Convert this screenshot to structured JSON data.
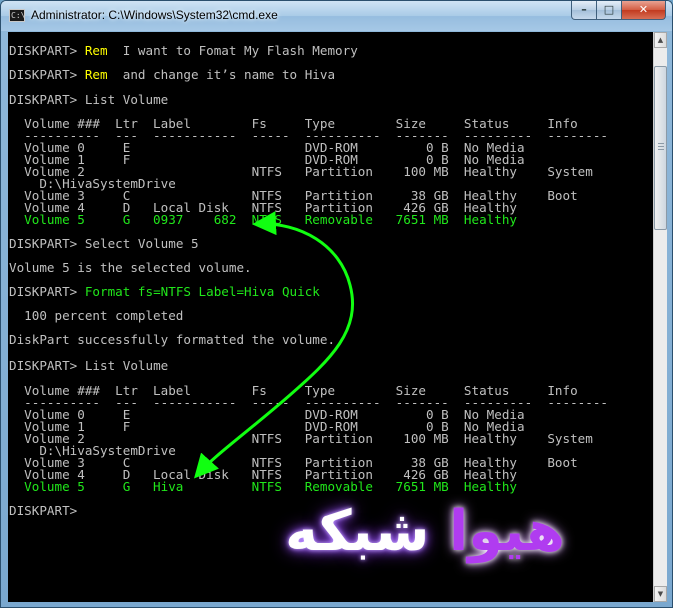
{
  "window": {
    "title": "Administrator: C:\\Windows\\System32\\cmd.exe",
    "app_icon": "C:\\",
    "controls": {
      "minimize": "–",
      "maximize": "□",
      "close": "✕"
    }
  },
  "console": {
    "lines": [
      {
        "prompt": "DISKPART> ",
        "cmd": "Rem",
        "rest": "  I want to Fomat My Flash Memory"
      },
      {
        "prompt": "DISKPART> ",
        "cmd": "Rem",
        "rest": "  and change it’s name to Hiva"
      },
      {
        "prompt": "DISKPART> ",
        "cmd": "",
        "rest": "List Volume"
      },
      {
        "text": "  Volume ###  Ltr  Label        Fs     Type        Size     Status     Info"
      },
      {
        "text": "  ----------  ---  -----------  -----  ----------  -------  ---------  --------"
      },
      {
        "text": "  Volume 0     E                       DVD-ROM         0 B  No Media"
      },
      {
        "text": "  Volume 1     F                       DVD-ROM         0 B  No Media"
      },
      {
        "text": "  Volume 2                      NTFS   Partition    100 MB  Healthy    System"
      },
      {
        "text": "    D:\\HivaSystemDrive"
      },
      {
        "text": "  Volume 3     C                NTFS   Partition     38 GB  Healthy    Boot"
      },
      {
        "text": "  Volume 4     D   Local Disk   NTFS   Partition    426 GB  Healthy"
      },
      {
        "text": "  Volume 5     G   0937    682  NTFS   Removable   7651 MB  Healthy",
        "green": true
      },
      {
        "prompt": "DISKPART> ",
        "cmd": "",
        "rest": "Select Volume 5"
      },
      {
        "text": "Volume 5 is the selected volume."
      },
      {
        "prompt": "DISKPART> ",
        "cmd": "Format fs=NTFS Label=Hiva Quick",
        "rest": "",
        "cmd_color": "green"
      },
      {
        "text": "  100 percent completed"
      },
      {
        "text": "DiskPart successfully formatted the volume."
      },
      {
        "prompt": "DISKPART> ",
        "cmd": "",
        "rest": "List Volume"
      },
      {
        "text": "  Volume ###  Ltr  Label        Fs     Type        Size     Status     Info"
      },
      {
        "text": "  ----------  ---  -----------  -----  ----------  -------  ---------  --------"
      },
      {
        "text": "  Volume 0     E                       DVD-ROM         0 B  No Media"
      },
      {
        "text": "  Volume 1     F                       DVD-ROM         0 B  No Media"
      },
      {
        "text": "  Volume 2                      NTFS   Partition    100 MB  Healthy    System"
      },
      {
        "text": "    D:\\HivaSystemDrive"
      },
      {
        "text": "  Volume 3     C                NTFS   Partition     38 GB  Healthy    Boot"
      },
      {
        "text": "  Volume 4     D   Local Disk   NTFS   Partition    426 GB  Healthy"
      },
      {
        "text": "  Volume 5     G   Hiva         NTFS   Removable   7651 MB  Healthy",
        "green": true
      },
      {
        "prompt": "DISKPART> ",
        "cmd": "",
        "rest": ""
      }
    ]
  },
  "watermark": {
    "text": "هیوا شبکه",
    "part_plain": "شبکه",
    "part_purple": "هیوا"
  },
  "colors": {
    "console_bg": "#000000",
    "console_text": "#c0c0c0",
    "highlight_green": "#21e81b",
    "rem_yellow": "#ffff00",
    "arrow_green": "#11ff11",
    "watermark_purple": "#b03cf0"
  },
  "icons": {
    "app": "cmd-icon",
    "scroll_up": "arrow-up-icon",
    "scroll_down": "arrow-down-icon"
  }
}
